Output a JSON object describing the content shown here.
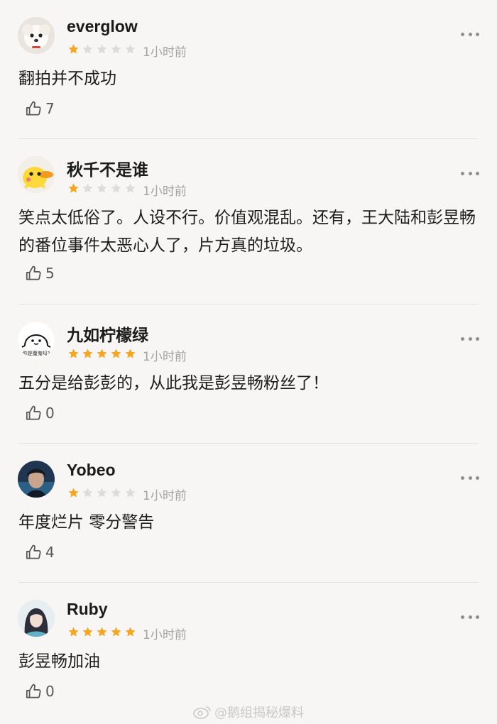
{
  "comments": [
    {
      "username": "everglow",
      "rating": 1,
      "time": "1小时前",
      "content": "翻拍并不成功",
      "likes": "7",
      "avatar_icon": "dog-avatar-icon"
    },
    {
      "username": "秋千不是谁",
      "rating": 1,
      "time": "1小时前",
      "content": "笑点太低俗了。人设不行。价值观混乱。还有，王大陆和彭昱畅的番位事件太恶心人了，片方真的垃圾。",
      "likes": "5",
      "avatar_icon": "duck-avatar-icon"
    },
    {
      "username": "九如柠檬绿",
      "rating": 5,
      "time": "1小时前",
      "content": "五分是给彭彭的，从此我是彭昱畅粉丝了！",
      "likes": "0",
      "avatar_icon": "ghost-avatar-icon",
      "avatar_caption": "你是魔鬼吗?"
    },
    {
      "username": "Yobeo",
      "rating": 1,
      "time": "1小时前",
      "content": "年度烂片 零分警告",
      "likes": "4",
      "avatar_icon": "person-avatar-icon"
    },
    {
      "username": "Ruby",
      "rating": 5,
      "time": "1小时前",
      "content": "彭昱畅加油",
      "likes": "0",
      "avatar_icon": "girl-avatar-icon"
    }
  ],
  "colors": {
    "star_filled": "#f5a623",
    "star_empty": "#dcdcdc",
    "background": "#f7f6f4"
  },
  "watermark": "@鹅组揭秘爆料"
}
